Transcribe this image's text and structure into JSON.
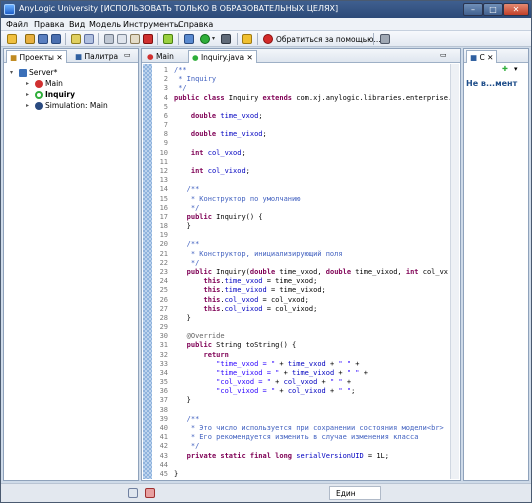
{
  "window": {
    "title": "AnyLogic University [ИСПОЛЬЗОВАТЬ ТОЛЬКО В ОБРАЗОВАТЕЛЬНЫХ ЦЕЛЯХ]",
    "btn_min": "–",
    "btn_max": "□",
    "btn_close": "✕"
  },
  "menu": [
    "Файл",
    "Правка",
    "Вид",
    "Модель",
    "Инструменты",
    "Справка"
  ],
  "toolbar": {
    "help_label": "Обратиться за помощью..."
  },
  "left_panel": {
    "tabs": [
      "Проекты",
      "Палитра"
    ],
    "tree": [
      {
        "label": "Server*",
        "icon": "project-icon",
        "expanded": true
      },
      {
        "label": "Main",
        "icon": "agent-icon"
      },
      {
        "label": "Inquiry",
        "icon": "java-class-icon",
        "bold": true
      },
      {
        "label": "Simulation: Main",
        "icon": "experiment-icon"
      }
    ]
  },
  "editor": {
    "tabs": [
      "Main",
      "Inquiry.java"
    ],
    "lines": [
      {
        "n": "1",
        "parts": [
          [
            "cm",
            "/**"
          ]
        ]
      },
      {
        "n": "2",
        "parts": [
          [
            "cm",
            " * Inquiry"
          ]
        ]
      },
      {
        "n": "3",
        "parts": [
          [
            "cm",
            " */"
          ]
        ]
      },
      {
        "n": "4",
        "parts": [
          [
            "kw",
            "public class"
          ],
          [
            "",
            " Inquiry "
          ],
          [
            "kw",
            "extends"
          ],
          [
            "",
            " com.xj.anylogic.libraries.enterprise."
          ]
        ]
      },
      {
        "n": "5",
        "parts": []
      },
      {
        "n": "6",
        "parts": [
          [
            "",
            "    "
          ],
          [
            "kw",
            "double"
          ],
          [
            "",
            " "
          ],
          [
            "fd",
            "time_vxod"
          ],
          [
            "",
            ";"
          ]
        ]
      },
      {
        "n": "7",
        "parts": []
      },
      {
        "n": "8",
        "parts": [
          [
            "",
            "    "
          ],
          [
            "kw",
            "double"
          ],
          [
            "",
            " "
          ],
          [
            "fd",
            "time_vixod"
          ],
          [
            "",
            ";"
          ]
        ]
      },
      {
        "n": "9",
        "parts": []
      },
      {
        "n": "10",
        "parts": [
          [
            "",
            "    "
          ],
          [
            "kw",
            "int"
          ],
          [
            "",
            " "
          ],
          [
            "fd",
            "col_vxod"
          ],
          [
            "",
            ";"
          ]
        ]
      },
      {
        "n": "11",
        "parts": []
      },
      {
        "n": "12",
        "parts": [
          [
            "",
            "    "
          ],
          [
            "kw",
            "int"
          ],
          [
            "",
            " "
          ],
          [
            "fd",
            "col_vixod"
          ],
          [
            "",
            ";"
          ]
        ]
      },
      {
        "n": "13",
        "parts": []
      },
      {
        "n": "14",
        "parts": [
          [
            "cm",
            "   /**"
          ]
        ]
      },
      {
        "n": "15",
        "parts": [
          [
            "cm",
            "    * Конструктор по умолчанию"
          ]
        ]
      },
      {
        "n": "16",
        "parts": [
          [
            "cm",
            "    */"
          ]
        ]
      },
      {
        "n": "17",
        "parts": [
          [
            "",
            "   "
          ],
          [
            "kw",
            "public"
          ],
          [
            "",
            " Inquiry() {"
          ]
        ]
      },
      {
        "n": "18",
        "parts": [
          [
            "",
            "   }"
          ]
        ]
      },
      {
        "n": "19",
        "parts": []
      },
      {
        "n": "20",
        "parts": [
          [
            "cm",
            "   /**"
          ]
        ]
      },
      {
        "n": "21",
        "parts": [
          [
            "cm",
            "    * Конструктор, инициализирующий поля"
          ]
        ]
      },
      {
        "n": "22",
        "parts": [
          [
            "cm",
            "    */"
          ]
        ]
      },
      {
        "n": "23",
        "parts": [
          [
            "",
            "   "
          ],
          [
            "kw",
            "public"
          ],
          [
            "",
            " Inquiry("
          ],
          [
            "kw",
            "double"
          ],
          [
            "",
            " time_vxod, "
          ],
          [
            "kw",
            "double"
          ],
          [
            "",
            " time_vixod, "
          ],
          [
            "kw",
            "int"
          ],
          [
            "",
            " col_vx"
          ]
        ]
      },
      {
        "n": "24",
        "parts": [
          [
            "",
            "       "
          ],
          [
            "kw",
            "this"
          ],
          [
            "",
            "."
          ],
          [
            "fd",
            "time_vxod"
          ],
          [
            "",
            " = time_vxod;"
          ]
        ]
      },
      {
        "n": "25",
        "parts": [
          [
            "",
            "       "
          ],
          [
            "kw",
            "this"
          ],
          [
            "",
            "."
          ],
          [
            "fd",
            "time_vixod"
          ],
          [
            "",
            " = time_vixod;"
          ]
        ]
      },
      {
        "n": "26",
        "parts": [
          [
            "",
            "       "
          ],
          [
            "kw",
            "this"
          ],
          [
            "",
            "."
          ],
          [
            "fd",
            "col_vxod"
          ],
          [
            "",
            " = col_vxod;"
          ]
        ]
      },
      {
        "n": "27",
        "parts": [
          [
            "",
            "       "
          ],
          [
            "kw",
            "this"
          ],
          [
            "",
            "."
          ],
          [
            "fd",
            "col_vixod"
          ],
          [
            "",
            " = col_vixod;"
          ]
        ]
      },
      {
        "n": "28",
        "parts": [
          [
            "",
            "   }"
          ]
        ]
      },
      {
        "n": "29",
        "parts": []
      },
      {
        "n": "30",
        "parts": [
          [
            "an",
            "   @Override"
          ]
        ]
      },
      {
        "n": "31",
        "parts": [
          [
            "",
            "   "
          ],
          [
            "kw",
            "public"
          ],
          [
            "",
            " String toString() {"
          ]
        ]
      },
      {
        "n": "32",
        "parts": [
          [
            "",
            "       "
          ],
          [
            "kw",
            "return"
          ]
        ]
      },
      {
        "n": "33",
        "parts": [
          [
            "",
            "          "
          ],
          [
            "st",
            "\"time_vxod = \""
          ],
          [
            "",
            " + "
          ],
          [
            "fd",
            "time_vxod"
          ],
          [
            "",
            " + "
          ],
          [
            "st",
            "\" \""
          ],
          [
            "",
            " +"
          ]
        ]
      },
      {
        "n": "34",
        "parts": [
          [
            "",
            "          "
          ],
          [
            "st",
            "\"time_vixod = \""
          ],
          [
            "",
            " + "
          ],
          [
            "fd",
            "time_vixod"
          ],
          [
            "",
            " + "
          ],
          [
            "st",
            "\" \""
          ],
          [
            "",
            " +"
          ]
        ]
      },
      {
        "n": "35",
        "parts": [
          [
            "",
            "          "
          ],
          [
            "st",
            "\"col_vxod = \""
          ],
          [
            "",
            " + "
          ],
          [
            "fd",
            "col_vxod"
          ],
          [
            "",
            " + "
          ],
          [
            "st",
            "\" \""
          ],
          [
            "",
            " +"
          ]
        ]
      },
      {
        "n": "36",
        "parts": [
          [
            "",
            "          "
          ],
          [
            "st",
            "\"col_vixod = \""
          ],
          [
            "",
            " + "
          ],
          [
            "fd",
            "col_vixod"
          ],
          [
            "",
            " + "
          ],
          [
            "st",
            "\" \""
          ],
          [
            "",
            ";"
          ]
        ]
      },
      {
        "n": "37",
        "parts": [
          [
            "",
            "   }"
          ]
        ]
      },
      {
        "n": "38",
        "parts": []
      },
      {
        "n": "39",
        "parts": [
          [
            "cm",
            "   /**"
          ]
        ]
      },
      {
        "n": "40",
        "parts": [
          [
            "cm",
            "    * Это число используется при сохранении состояния модели<br>"
          ]
        ]
      },
      {
        "n": "41",
        "parts": [
          [
            "cm",
            "    * Его рекомендуется изменить в случае изменения класса"
          ]
        ]
      },
      {
        "n": "42",
        "parts": [
          [
            "cm",
            "    */"
          ]
        ]
      },
      {
        "n": "43",
        "parts": [
          [
            "",
            "   "
          ],
          [
            "kw",
            "private static final long"
          ],
          [
            "",
            " "
          ],
          [
            "fd",
            "serialVersionUID"
          ],
          [
            "",
            " = 1L;"
          ]
        ]
      },
      {
        "n": "44",
        "parts": []
      },
      {
        "n": "45",
        "parts": [
          [
            "",
            "}"
          ]
        ]
      }
    ]
  },
  "right_panel": {
    "tab": "С",
    "heading": "Не в...мент"
  },
  "status": {
    "language": "Един"
  }
}
